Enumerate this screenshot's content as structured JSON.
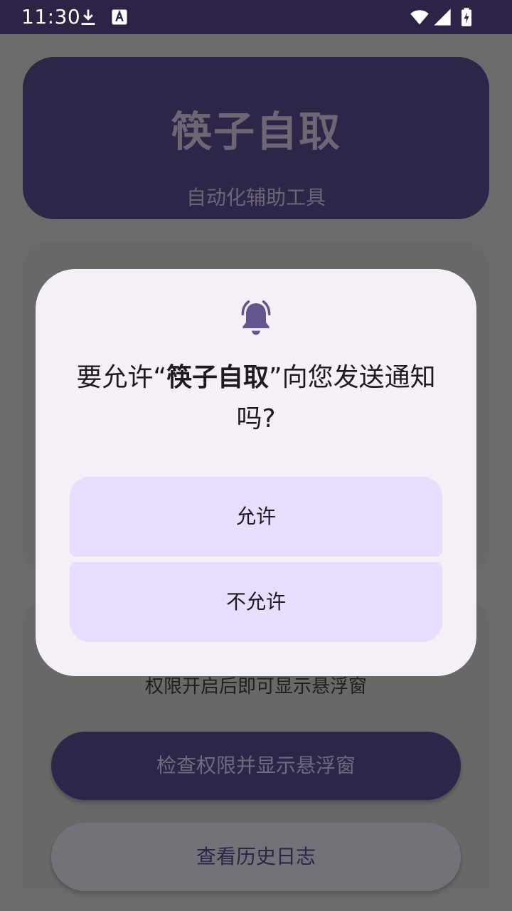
{
  "status_bar": {
    "time": "11:30",
    "icons": [
      "download-icon",
      "text-a-icon",
      "wifi-icon",
      "signal-icon",
      "battery-charging-icon"
    ]
  },
  "app": {
    "title": "筷子自取",
    "subtitle": "自动化辅助工具",
    "permission_hint": "权限开启后即可显示悬浮窗",
    "check_button_label": "检查权限并显示悬浮窗",
    "history_button_label": "查看历史日志"
  },
  "dialog": {
    "icon": "notification-bell-icon",
    "message_prefix": "要允许“",
    "app_name": "筷子自取",
    "message_suffix": "”向您发送通知吗?",
    "allow_label": "允许",
    "deny_label": "不允许"
  },
  "colors": {
    "status_bar_bg": "#2e2246",
    "scrim_bg": "#6b6b6b",
    "header_bg": "#2e2649",
    "dialog_bg": "#f5f0f7",
    "dialog_button_bg": "#e7ddff",
    "bell_color": "#65558f"
  }
}
